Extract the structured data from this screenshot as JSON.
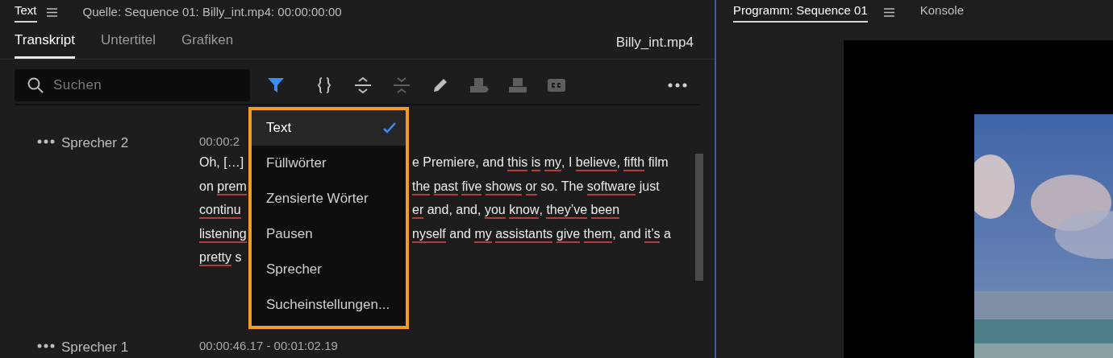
{
  "left_panel": {
    "header_tabs": [
      {
        "label": "Text",
        "selected": true
      }
    ],
    "source_label": "Quelle: Sequence 01: Billy_int.mp4: 00:00:00:00",
    "tabs": [
      {
        "label": "Transkript",
        "selected": true
      },
      {
        "label": "Untertitel",
        "selected": false
      },
      {
        "label": "Grafiken",
        "selected": false
      }
    ],
    "clip_name": "Billy_int.mp4",
    "search": {
      "placeholder": "Suchen"
    },
    "toolbar": [
      {
        "kind": "filter",
        "active": true,
        "disabled": false
      },
      {
        "kind": "braces",
        "active": false,
        "disabled": false
      },
      {
        "kind": "expand",
        "active": false,
        "disabled": false
      },
      {
        "kind": "collapse",
        "active": false,
        "disabled": true
      },
      {
        "kind": "pencil",
        "active": false,
        "disabled": false
      },
      {
        "kind": "insert",
        "active": false,
        "disabled": true
      },
      {
        "kind": "overwrite",
        "active": false,
        "disabled": true
      },
      {
        "kind": "captions",
        "active": false,
        "disabled": true
      }
    ],
    "filter_menu": [
      {
        "label": "Text",
        "checked": true
      },
      {
        "label": "Füllwörter",
        "checked": false
      },
      {
        "label": "Zensierte Wörter",
        "checked": false
      },
      {
        "label": "Pausen",
        "checked": false
      },
      {
        "label": "Sprecher",
        "checked": false
      },
      {
        "label": "Sucheinstellungen...",
        "checked": false
      }
    ],
    "segments": [
      {
        "speaker": "Sprecher 2",
        "time": "00:00:2",
        "lines": [
          {
            "left": [
              {
                "text": "Oh, […]",
                "underlined": false
              }
            ],
            "right": [
              {
                "text": "e Premiere, and",
                "underlined": false
              },
              {
                "text": "this",
                "underlined": true
              },
              {
                "text": "is",
                "underlined": true
              },
              {
                "text": "my",
                "underlined": true,
                "tail": ", I"
              },
              {
                "text": "believe",
                "underlined": true,
                "tail": ","
              },
              {
                "text": "fifth",
                "underlined": true
              },
              {
                "text": "film",
                "underlined": false
              }
            ]
          },
          {
            "left": [
              {
                "text": "on",
                "underlined": false
              },
              {
                "text": "prem",
                "underlined": true
              }
            ],
            "right": [
              {
                "text": "the",
                "underlined": true
              },
              {
                "text": "past",
                "underlined": true
              },
              {
                "text": "five",
                "underlined": true
              },
              {
                "text": "shows",
                "underlined": true
              },
              {
                "text": "or",
                "underlined": true
              },
              {
                "text": "so. The",
                "underlined": false
              },
              {
                "text": "software",
                "underlined": true
              },
              {
                "text": "just",
                "underlined": false
              }
            ]
          },
          {
            "left": [
              {
                "text": "continu",
                "underlined": true
              }
            ],
            "right": [
              {
                "text": "er",
                "underlined": true
              },
              {
                "text": "and, and,",
                "underlined": false
              },
              {
                "text": "you",
                "underlined": true
              },
              {
                "text": "know",
                "underlined": true,
                "tail": ","
              },
              {
                "text": "they’ve",
                "underlined": true
              },
              {
                "text": "been",
                "underlined": true
              }
            ]
          },
          {
            "left": [
              {
                "text": "listening",
                "underlined": true
              }
            ],
            "right": [
              {
                "text": "nyself",
                "underlined": true
              },
              {
                "text": "and",
                "underlined": false
              },
              {
                "text": "my",
                "underlined": true
              },
              {
                "text": "assistants",
                "underlined": true
              },
              {
                "text": "give",
                "underlined": true
              },
              {
                "text": "them",
                "underlined": true,
                "tail": ", and"
              },
              {
                "text": "it’s",
                "underlined": true
              },
              {
                "text": "a",
                "underlined": false
              }
            ]
          },
          {
            "left": [
              {
                "text": "pretty",
                "underlined": true
              },
              {
                "text": "s",
                "underlined": false
              }
            ]
          }
        ]
      },
      {
        "speaker": "Sprecher 1",
        "time": "00:00:46.17 - 00:01:02.19"
      }
    ]
  },
  "right_panel": {
    "tabs": [
      {
        "label": "Programm: Sequence 01",
        "selected": true
      },
      {
        "label": "Konsole",
        "selected": false
      }
    ]
  }
}
